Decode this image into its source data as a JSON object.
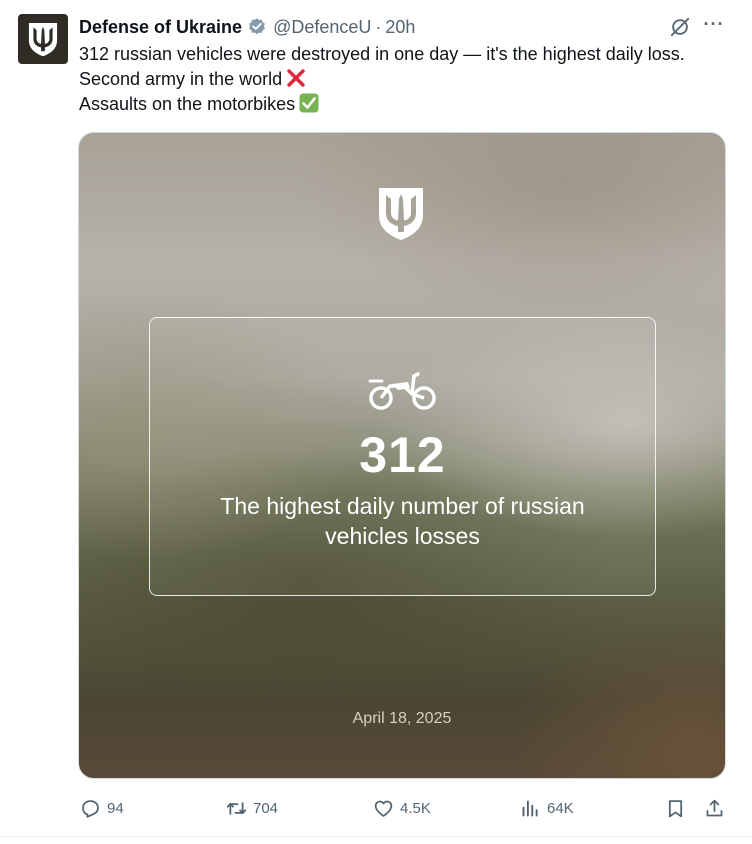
{
  "author": {
    "name": "Defense of Ukraine",
    "handle": "@DefenceU",
    "separator": "·",
    "time": "20h"
  },
  "tweet_text": {
    "line1": "312 russian vehicles were destroyed in one day — it's the highest daily loss.",
    "line2": "Second army in the world",
    "line2_emoji": "cross-mark-emoji",
    "line3": "Assaults on the motorbikes",
    "line3_emoji": "check-mark-emoji"
  },
  "media": {
    "number": "312",
    "caption_line1": "The highest daily number of russian",
    "caption_line2": "vehicles losses",
    "date": "April 18, 2025",
    "icons": [
      "trident-shield-icon",
      "motorcycle-icon"
    ]
  },
  "actions": {
    "replies": "94",
    "reposts": "704",
    "likes": "4.5K",
    "views": "64K"
  },
  "colors": {
    "text": "#0f1419",
    "secondary": "#536471",
    "verified": "#829aab",
    "avatar_bg": "#2e2c24"
  }
}
